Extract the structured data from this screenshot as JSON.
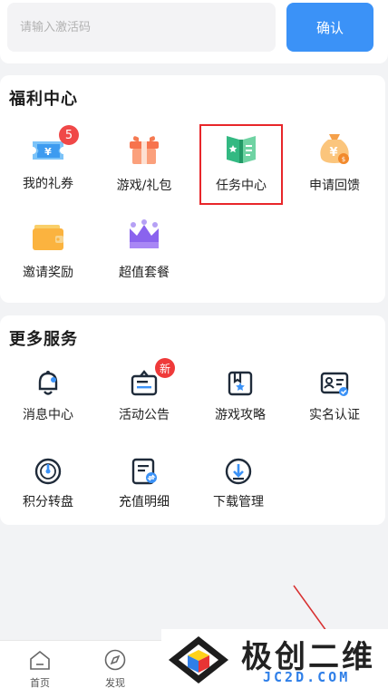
{
  "activation": {
    "placeholder": "请输入激活码",
    "confirm_label": "确认"
  },
  "welfare": {
    "title": "福利中心",
    "items": [
      {
        "label": "我的礼券",
        "icon": "ticket-icon",
        "badge": "5"
      },
      {
        "label": "游戏/礼包",
        "icon": "gift-box-icon"
      },
      {
        "label": "任务中心",
        "icon": "task-book-icon",
        "highlighted": true
      },
      {
        "label": "申请回馈",
        "icon": "money-bag-icon"
      },
      {
        "label": "邀请奖励",
        "icon": "wallet-icon"
      },
      {
        "label": "超值套餐",
        "icon": "crown-icon"
      }
    ]
  },
  "services": {
    "title": "更多服务",
    "items": [
      {
        "label": "消息中心",
        "icon": "bell-icon"
      },
      {
        "label": "活动公告",
        "icon": "announcement-icon",
        "badge": "新"
      },
      {
        "label": "游戏攻略",
        "icon": "bookmark-star-icon"
      },
      {
        "label": "实名认证",
        "icon": "id-card-icon"
      },
      {
        "label": "积分转盘",
        "icon": "wheel-icon"
      },
      {
        "label": "充值明细",
        "icon": "recharge-list-icon"
      },
      {
        "label": "下载管理",
        "icon": "download-icon"
      }
    ]
  },
  "bottom_nav": {
    "items": [
      {
        "label": "首页",
        "icon": "home-icon"
      },
      {
        "label": "发现",
        "icon": "compass-icon"
      }
    ]
  },
  "watermark": {
    "text_cn": "极创二维",
    "text_en": "JC2D.COM"
  },
  "colors": {
    "accent": "#3b92f7",
    "highlight_border": "#e8262a",
    "badge": "#f04848"
  }
}
